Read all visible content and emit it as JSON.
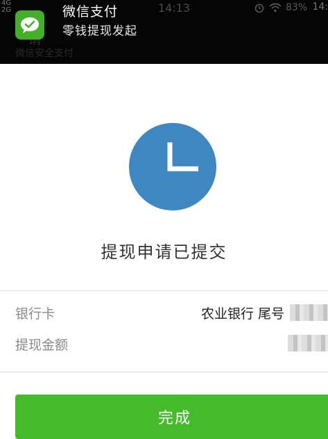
{
  "status_bar": {
    "signal_top": "4G",
    "signal_bottom": "2G",
    "time": "14:13",
    "battery": "83%",
    "edge_time": "14:"
  },
  "notification": {
    "app_name": "微信支付",
    "message": "零钱提现发起",
    "icon": "wechat-icon"
  },
  "background_header": {
    "title": "请",
    "subtitle": "微信安全支付"
  },
  "result": {
    "icon": "clock-icon",
    "title": "提现申请已提交",
    "icon_color": "#3e87c0"
  },
  "details": [
    {
      "label": "银行卡",
      "value": "农业银行 尾号"
    },
    {
      "label": "提现金额",
      "value": ""
    }
  ],
  "done_button": {
    "label": "完成",
    "color": "#45bb2b"
  }
}
